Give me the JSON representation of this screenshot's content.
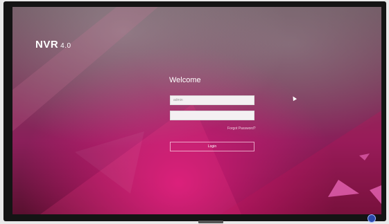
{
  "app": {
    "name": "NVR",
    "version": "4.0"
  },
  "login": {
    "welcome": "Welcome",
    "username_value": "admin",
    "password_value": "",
    "forgot_password": "Forgot Password?",
    "login_button": "Login"
  },
  "colors": {
    "background_primary": "#8a1f5a",
    "background_highlight": "#d41a78",
    "text": "#ffffff"
  }
}
